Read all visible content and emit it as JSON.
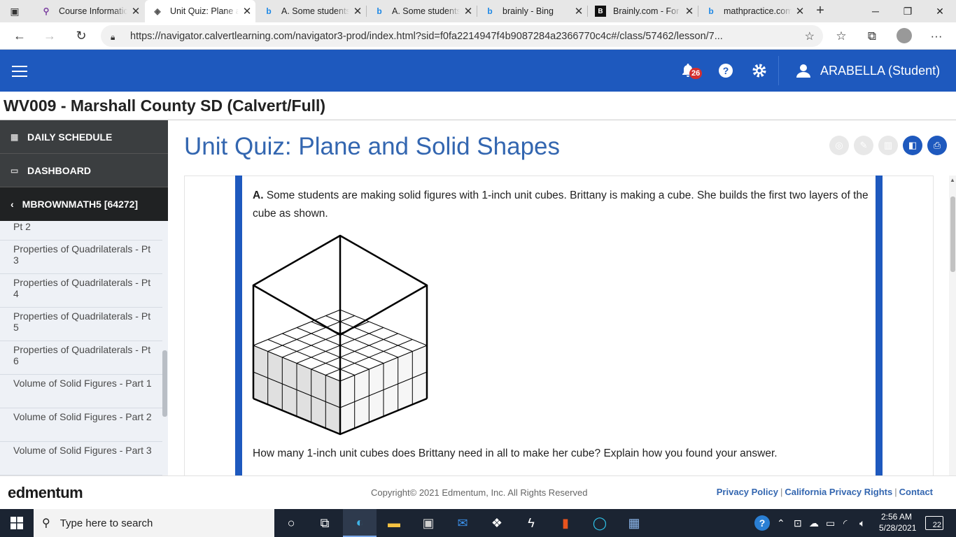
{
  "browser": {
    "tabs": [
      {
        "title": "Course Informatio",
        "icon": "calvert-icon",
        "color": "#7b3fa0"
      },
      {
        "title": "Unit Quiz: Plane a",
        "icon": "navigator-icon",
        "color": "#555"
      },
      {
        "title": "A. Some students",
        "icon": "bing-icon",
        "color": "#1e88e5"
      },
      {
        "title": "A. Some students",
        "icon": "bing-icon",
        "color": "#1e88e5"
      },
      {
        "title": "brainly - Bing",
        "icon": "bing-icon",
        "color": "#1e88e5"
      },
      {
        "title": "Brainly.com - For",
        "icon": "brainly-icon",
        "color": "#111"
      },
      {
        "title": "mathpractice.com",
        "icon": "bing-icon",
        "color": "#1e88e5"
      }
    ],
    "url": "https://navigator.calvertlearning.com/navigator3-prod/index.html?sid=f0fa2214947f4b9087284a2366770c4c#/class/57462/lesson/7..."
  },
  "header": {
    "notification_count": "26",
    "user_name": "ARABELLA (Student)",
    "org": "WV009 - Marshall County SD (Calvert/Full)",
    "accent": "#1e59be"
  },
  "sidebar": {
    "daily_schedule": "DAILY SCHEDULE",
    "dashboard": "DASHBOARD",
    "course": "MBROWNMATH5 [64272]",
    "lessons": [
      "Pt 2",
      "Properties of Quadrilaterals - Pt 3",
      "Properties of Quadrilaterals - Pt 4",
      "Properties of Quadrilaterals - Pt 5",
      "Properties of Quadrilaterals - Pt 6",
      "Volume of Solid Figures - Part 1",
      "Volume of Solid Figures - Part 2",
      "Volume of Solid Figures - Part 3"
    ]
  },
  "main": {
    "title": "Unit Quiz: Plane and Solid Shapes",
    "question_label": "A.",
    "question_text": "Some students are making solid figures with 1-inch unit cubes. Brittany is making a cube. She builds the first two layers of the cube as shown.",
    "question2": "How many 1-inch unit cubes does Brittany need in all to make her cube? Explain how you found your answer."
  },
  "footer": {
    "logo": "edmentum",
    "copyright": "Copyright© 2021 Edmentum, Inc. All Rights Reserved",
    "links": [
      "Privacy Policy",
      "California Privacy Rights",
      "Contact"
    ]
  },
  "taskbar": {
    "search_placeholder": "Type here to search",
    "time": "2:56 AM",
    "date": "5/28/2021",
    "notifications": "22"
  }
}
